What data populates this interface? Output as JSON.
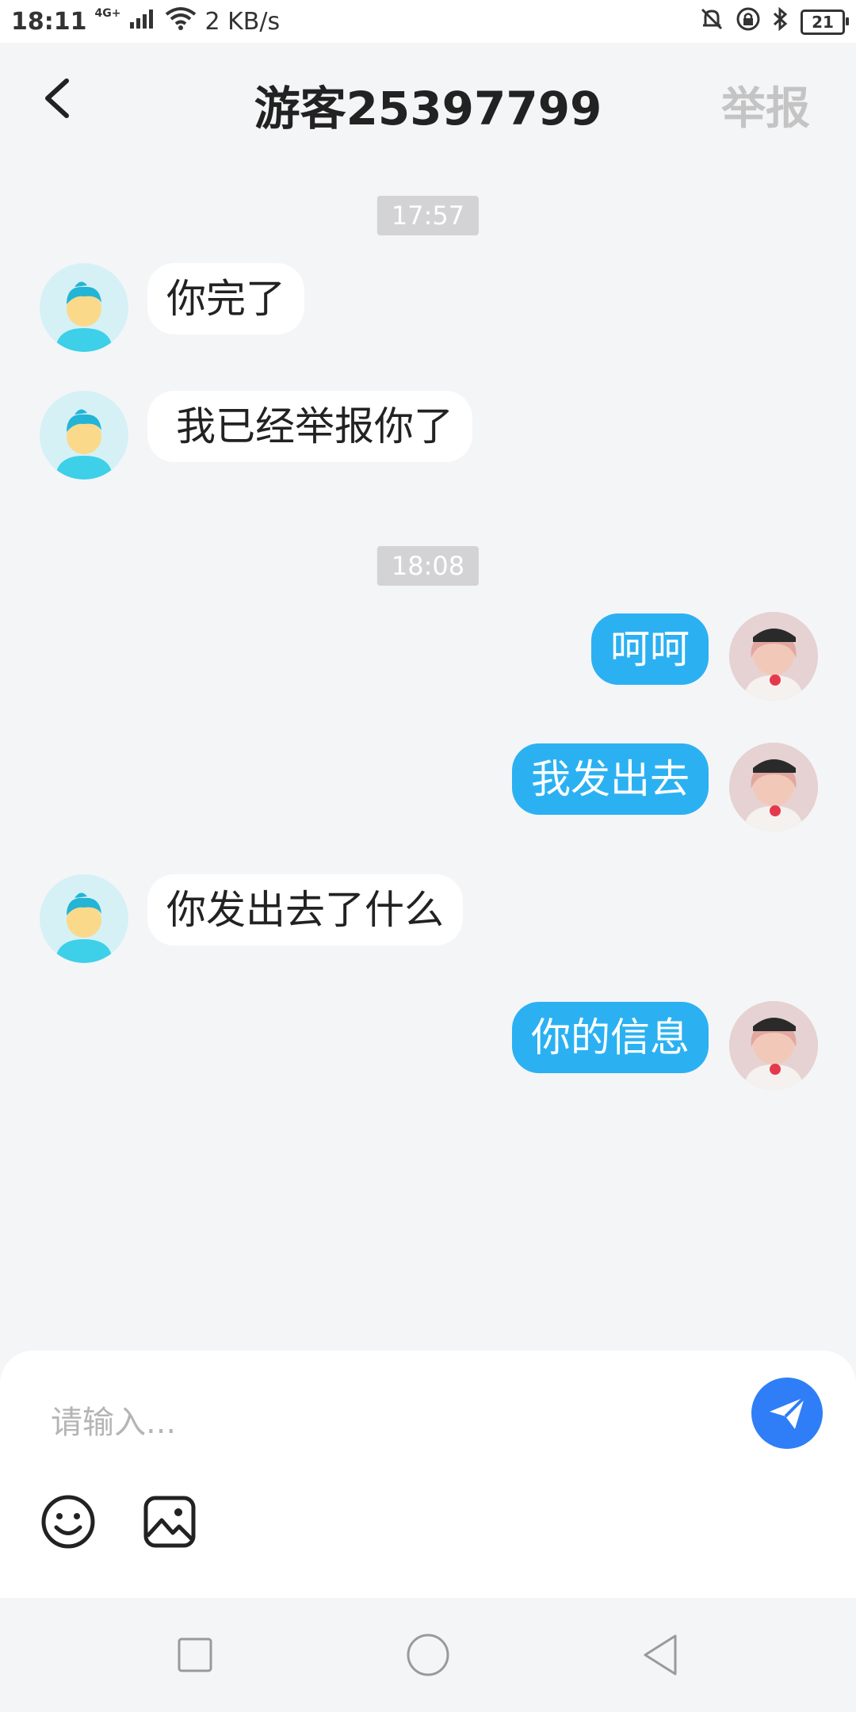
{
  "status_bar": {
    "time": "18:11",
    "network": "4G+",
    "speed": "2 KB/s",
    "battery": "21"
  },
  "header": {
    "title": "游客25397799",
    "report_label": "举报"
  },
  "messages": [
    {
      "type": "time",
      "text": "17:57"
    },
    {
      "type": "msg",
      "side": "left",
      "text": "你完了"
    },
    {
      "type": "msg",
      "side": "left",
      "text": "我已经举报你了"
    },
    {
      "type": "time",
      "text": "18:08"
    },
    {
      "type": "msg",
      "side": "right",
      "text": "呵呵"
    },
    {
      "type": "msg",
      "side": "right",
      "text": "我发出去"
    },
    {
      "type": "msg",
      "side": "left",
      "text": "你发出去了什么"
    },
    {
      "type": "msg",
      "side": "right",
      "text": "你的信息"
    }
  ],
  "input": {
    "placeholder": "请输入..."
  },
  "icons": {
    "back": "chevron-left-icon",
    "send": "paper-plane-icon",
    "emoji": "smiley-icon",
    "image": "image-icon",
    "nav_recent": "square-icon",
    "nav_home": "circle-icon",
    "nav_back": "triangle-back-icon"
  },
  "colors": {
    "accent_blue": "#2bb1f2",
    "send_blue": "#2f7ef7",
    "background": "#f4f5f7",
    "report_gray": "#c4c4c4"
  }
}
